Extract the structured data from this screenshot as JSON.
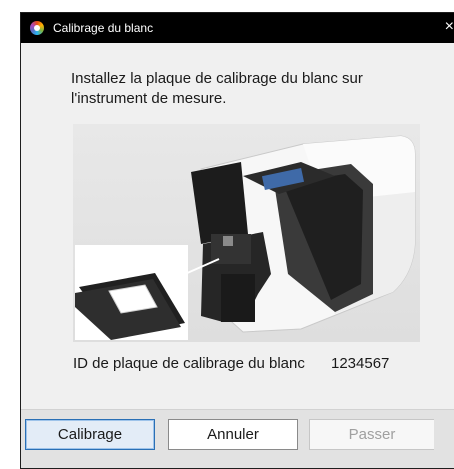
{
  "window": {
    "title": "Calibrage du blanc",
    "close_glyph": "×"
  },
  "instruction": "Installez la plaque de calibrage du blanc sur l'instrument de mesure.",
  "image": {
    "description_icon": "spectrophotometer-illustration"
  },
  "plate_id": {
    "label": "ID de plaque de calibrage du blanc",
    "value": "1234567"
  },
  "buttons": {
    "calibrate": "Calibrage",
    "cancel": "Annuler",
    "skip": "Passer"
  }
}
